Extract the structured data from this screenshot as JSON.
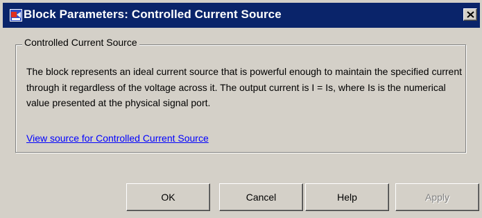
{
  "window": {
    "title": "Block Parameters: Controlled Current Source",
    "title_icon": "simulink-block-icon",
    "close_label": "close-icon"
  },
  "group": {
    "title": "Controlled Current Source",
    "description": "The block represents an ideal current source that is powerful enough to maintain the specified current through it regardless of the voltage across it. The output current is I = Is, where Is is the numerical value presented at the physical signal port.",
    "link_text": "View source for Controlled Current Source"
  },
  "buttons": {
    "ok": "OK",
    "cancel": "Cancel",
    "help": "Help",
    "apply": "Apply"
  },
  "colors": {
    "titlebar": "#0a246a",
    "link": "#0000ff",
    "disabled_text": "#808080"
  }
}
